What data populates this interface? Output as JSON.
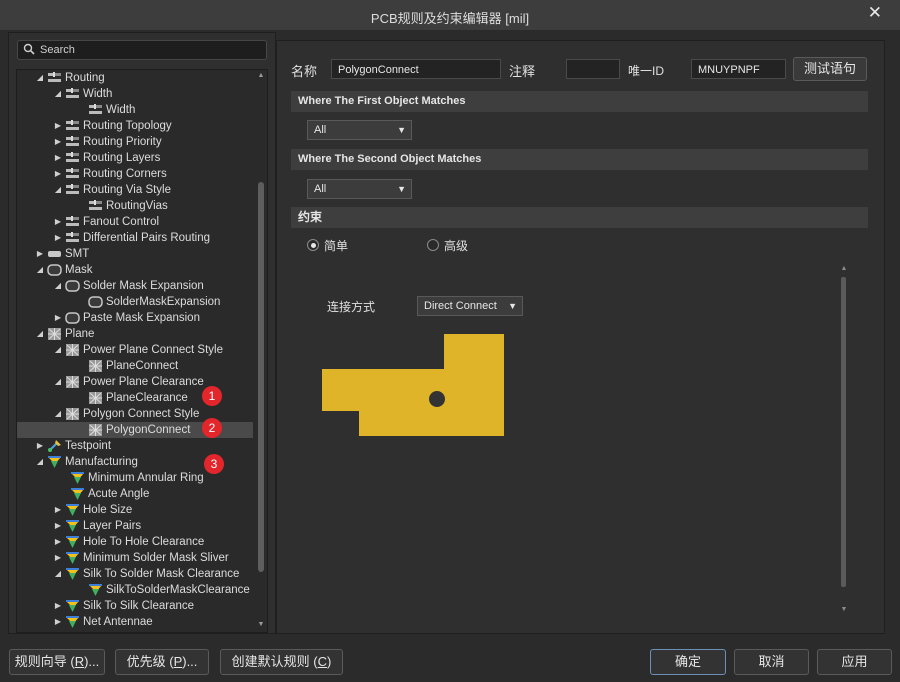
{
  "window": {
    "title": "PCB规则及约束编辑器 [mil]",
    "close_glyph": "✕"
  },
  "search": {
    "placeholder": "Search"
  },
  "tree": [
    {
      "label": "Routing",
      "arrow": "◢",
      "icon": "rule-icon"
    },
    {
      "label": "Width",
      "arrow": "◢",
      "icon": "rule-icon"
    },
    {
      "label": "Width",
      "arrow": "",
      "icon": "rule-icon"
    },
    {
      "label": "Routing Topology",
      "arrow": "▶",
      "icon": "rule-icon"
    },
    {
      "label": "Routing Priority",
      "arrow": "▶",
      "icon": "rule-icon"
    },
    {
      "label": "Routing Layers",
      "arrow": "▶",
      "icon": "rule-icon"
    },
    {
      "label": "Routing Corners",
      "arrow": "▶",
      "icon": "rule-icon"
    },
    {
      "label": "Routing Via Style",
      "arrow": "◢",
      "icon": "rule-icon"
    },
    {
      "label": "RoutingVias",
      "arrow": "",
      "icon": "rule-icon"
    },
    {
      "label": "Fanout Control",
      "arrow": "▶",
      "icon": "rule-icon"
    },
    {
      "label": "Differential Pairs Routing",
      "arrow": "▶",
      "icon": "rule-icon"
    },
    {
      "label": "SMT",
      "arrow": "▶",
      "icon": "smt-icon"
    },
    {
      "label": "Mask",
      "arrow": "◢",
      "icon": "mask-icon"
    },
    {
      "label": "Solder Mask Expansion",
      "arrow": "◢",
      "icon": "mask-icon"
    },
    {
      "label": "SolderMaskExpansion",
      "arrow": "",
      "icon": "mask-icon"
    },
    {
      "label": "Paste Mask Expansion",
      "arrow": "▶",
      "icon": "mask-icon"
    },
    {
      "label": "Plane",
      "arrow": "◢",
      "icon": "plane-icon"
    },
    {
      "label": "Power Plane Connect Style",
      "arrow": "◢",
      "icon": "plane-icon"
    },
    {
      "label": "PlaneConnect",
      "arrow": "",
      "icon": "plane-icon"
    },
    {
      "label": "Power Plane Clearance",
      "arrow": "◢",
      "icon": "plane-icon"
    },
    {
      "label": "PlaneClearance",
      "arrow": "",
      "icon": "plane-icon"
    },
    {
      "label": "Polygon Connect Style",
      "arrow": "◢",
      "icon": "plane-icon"
    },
    {
      "label": "PolygonConnect",
      "arrow": "",
      "icon": "plane-icon"
    },
    {
      "label": "Testpoint",
      "arrow": "▶",
      "icon": "testpoint-icon"
    },
    {
      "label": "Manufacturing",
      "arrow": "◢",
      "icon": "manufacturing-icon"
    },
    {
      "label": "Minimum Annular Ring",
      "arrow": "",
      "icon": "manufacturing-icon"
    },
    {
      "label": "Acute Angle",
      "arrow": "",
      "icon": "manufacturing-icon"
    },
    {
      "label": "Hole Size",
      "arrow": "▶",
      "icon": "manufacturing-icon"
    },
    {
      "label": "Layer Pairs",
      "arrow": "▶",
      "icon": "manufacturing-icon"
    },
    {
      "label": "Hole To Hole Clearance",
      "arrow": "▶",
      "icon": "manufacturing-icon"
    },
    {
      "label": "Minimum Solder Mask Sliver",
      "arrow": "▶",
      "icon": "manufacturing-icon"
    },
    {
      "label": "Silk To Solder Mask Clearance",
      "arrow": "◢",
      "icon": "manufacturing-icon"
    },
    {
      "label": "SilkToSolderMaskClearance",
      "arrow": "",
      "icon": "manufacturing-icon"
    },
    {
      "label": "Silk To Silk Clearance",
      "arrow": "▶",
      "icon": "manufacturing-icon"
    },
    {
      "label": "Net Antennae",
      "arrow": "▶",
      "icon": "manufacturing-icon"
    }
  ],
  "badges": [
    "1",
    "2",
    "3"
  ],
  "rule": {
    "name_label": "名称",
    "name_value": "PolygonConnect",
    "comment_label": "注释",
    "comment_value": "",
    "uid_label": "唯一ID",
    "uid_value": "MNUYPNPF",
    "test_button": "测试语句"
  },
  "first_match": {
    "header": "Where The First Object Matches",
    "selected": "All"
  },
  "second_match": {
    "header": "Where The Second Object Matches",
    "selected": "All"
  },
  "constraints": {
    "header": "约束",
    "mode_simple": "简单",
    "mode_advanced": "高级",
    "connect_label": "连接方式",
    "connect_selected": "Direct Connect",
    "preview_color": "#e0b428"
  },
  "footer": {
    "wizard": "规则向导",
    "wizard_key": "R",
    "priority": "优先级",
    "priority_key": "P",
    "default_rules": "创建默认规则",
    "default_key": "C",
    "ok": "确定",
    "cancel": "取消",
    "apply": "应用"
  }
}
